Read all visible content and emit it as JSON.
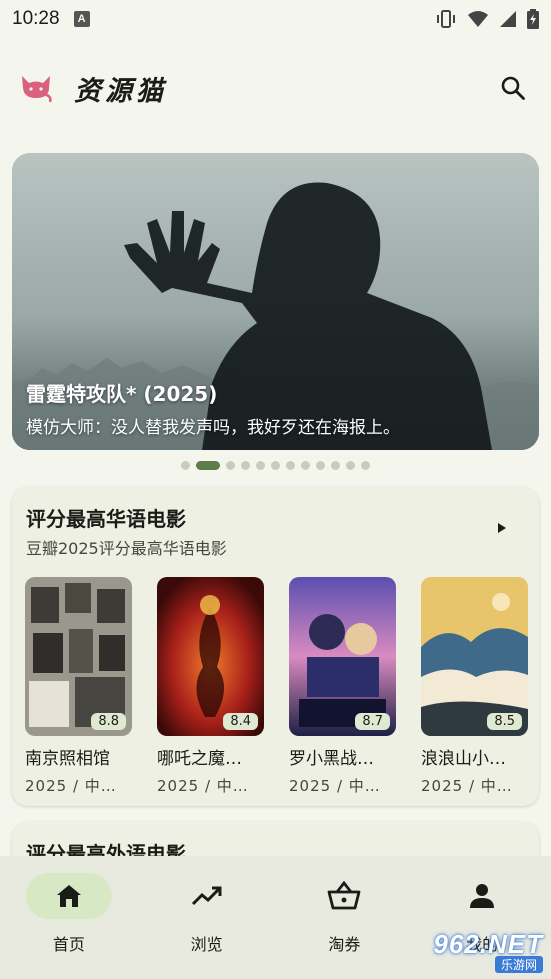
{
  "status_bar": {
    "time": "10:28",
    "notification_letter": "A",
    "icons": [
      "vibrate-icon",
      "wifi-icon",
      "signal-icon",
      "battery-icon"
    ]
  },
  "app_bar": {
    "title": "资源猫",
    "logo_icon": "cat-logo-icon",
    "search_icon": "search-icon"
  },
  "banner": {
    "title": "雷霆特攻队* (2025)",
    "subtitle": "模仿大师：没人替我发声吗，我好歹还在海报上。",
    "dot_count": 12,
    "active_index": 1
  },
  "section1": {
    "title": "评分最高华语电影",
    "subtitle": "豆瓣2025评分最高华语电影",
    "arrow_icon": "play-arrow-icon",
    "movies": [
      {
        "title": "南京照相馆",
        "meta": "2025 / 中…",
        "rating": "8.8",
        "poster_color": "#7b7a72"
      },
      {
        "title": "哪吒之魔…",
        "meta": "2025 / 中…",
        "rating": "8.4",
        "poster_color": "#b0281c"
      },
      {
        "title": "罗小黑战…",
        "meta": "2025 / 中…",
        "rating": "8.7",
        "poster_color": "#3b3a7a"
      },
      {
        "title": "浪浪山小…",
        "meta": "2025 / 中…",
        "rating": "8.5",
        "poster_color": "#d9b25a"
      }
    ]
  },
  "section2": {
    "title": "评分最高外语电影"
  },
  "bottom_nav": {
    "items": [
      {
        "label": "首页",
        "icon": "home-icon",
        "active": true
      },
      {
        "label": "浏览",
        "icon": "trending-icon",
        "active": false
      },
      {
        "label": "淘券",
        "icon": "basket-icon",
        "active": false
      },
      {
        "label": "我的",
        "icon": "person-icon",
        "active": false
      }
    ]
  },
  "watermark": {
    "main": "962.NET",
    "sub": "乐游网"
  },
  "colors": {
    "background": "#f4f5ec",
    "accent": "#5f7a4b",
    "active_pill": "#d6e8c4",
    "logo": "#d9607e"
  }
}
